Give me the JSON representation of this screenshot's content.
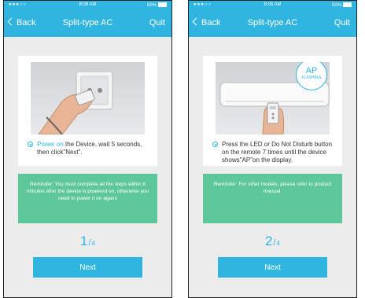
{
  "colors": {
    "accent": "#2fb5e0",
    "reminder": "#5ec79a"
  },
  "screens": [
    {
      "status": {
        "signal": "●●●○○ ",
        "time": "8:08 AM",
        "battery": "50%"
      },
      "nav": {
        "back": "Back",
        "title": "Split-type AC",
        "quit": "Quit"
      },
      "step": {
        "highlight": "Power on",
        "text": " the Device, wait 5 seconds, then click\"Next\"."
      },
      "reminder": "Reminder: You must complete all the steps within 8 minutes after the device is powered on, otherwise you need to power it on again!",
      "counter": {
        "current": "1",
        "separator": "/",
        "total": "4"
      },
      "next_label": "Next"
    },
    {
      "status": {
        "signal": "●●●○○ ",
        "time": "8:08 AM",
        "battery": "50%"
      },
      "nav": {
        "back": "Back",
        "title": "Split-type AC",
        "quit": "Quit"
      },
      "step": {
        "highlight": "",
        "text": "Press the LED or Do Not Disturb button on the remote 7 times until the device shows\"AP\"on the display."
      },
      "bubble": {
        "title": "AP",
        "subtitle": "FLASHING"
      },
      "reminder": "Reminder: For other models, please refer to product manual.",
      "counter": {
        "current": "2",
        "separator": "/",
        "total": "4"
      },
      "next_label": "Next"
    }
  ]
}
